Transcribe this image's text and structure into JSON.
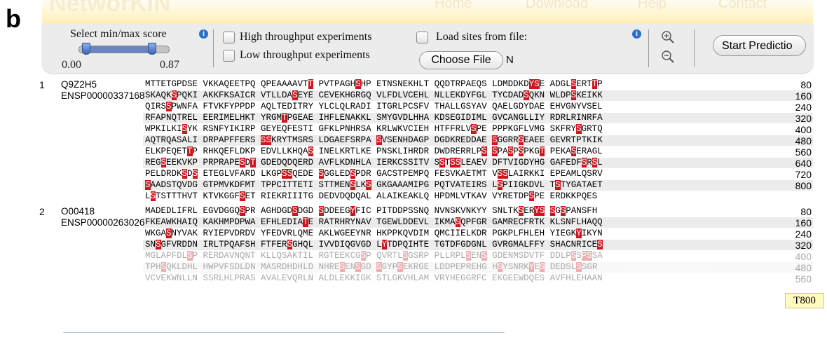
{
  "figure_label": "b",
  "banner": {
    "title": "NetworKIN",
    "nav": [
      "Home",
      "Download",
      "Help",
      "Contact"
    ]
  },
  "toolbar": {
    "score_label": "Select min/max score",
    "min_value": "0.00",
    "max_value": "0.87",
    "slider_min_fraction": 0.0,
    "slider_max_fraction": 0.87,
    "info_glyph": "i",
    "high_throughput_label": "High throughput experiments",
    "low_throughput_label": "Low throughput experiments",
    "load_sites_label": "Load sites from file:",
    "choose_file_label": "Choose File",
    "file_status": "N",
    "start_label": "Start Predictio",
    "zoom_in_icon": "zoom-in-icon",
    "zoom_out_icon": "zoom-out-icon"
  },
  "highlight_color": "#d2141c",
  "tooltip": "T800",
  "proteins": [
    {
      "index": "1",
      "ids": [
        "Q9Z2H5",
        "ENSP00000337168"
      ],
      "rows": [
        {
          "seq": "MTTETGPDSE VKKAQEETPQ QPEAAAAVT[T] PVTPAGH[S]HP ETNSNEKHLT QQDTRPAEQS LDMDDKD[YS]E ADGL[S]ERT[T]P",
          "pos": "80"
        },
        {
          "seq": "SKAQK[S]PQKI AKKFKSAICR VTLLDA[S]EYE CEVEKHGRGQ VLFDLVCEHL NLLEKDYFGL TYCDAD[S]QKN WLDP[S]KEIKK",
          "pos": "160"
        },
        {
          "seq": "QIRS[S]PWNFA FTVKFYPPDP AQLTEDITRY YLCLQLRADI ITGRLPCSFV THALLGSYAV QAELGDYDAE EHVGNYVSEL",
          "pos": "240"
        },
        {
          "seq": "RFAPNQTREL EERIMELHKT YRGM[T]PGEAE IHFLENAKKL SMYGVDLHHA KDSEGIDIML GVCANGLLIY RDRLRINRFA",
          "pos": "320"
        },
        {
          "seq": "WPKILKI[S]YK RSNFYIKIRP GEYEQFESTI GFKLPNHRSA KRLWKVCIEH HTFFRLV[S]PE PPPKGFLVMG SKFRY[S]GRTQ",
          "pos": "400"
        },
        {
          "seq": "AQTRQASALI DRPAPFFERS [SS]KRYTMSRS LDGAEFSRPA [S]VSENHDAGP DGDKREDDAE [S]GGRR[S]EAEE GEVRTPTKIK",
          "pos": "480"
        },
        {
          "seq": "ELKPEQET[T]P RHKQEFLDKP EDVLLKHQA[S] INELKRTLKE PNSKLIHRDR DWDRERRLP[S] [S]PA[S]P[S]PKG[T] PEKA[S]ERAGL",
          "pos": "560"
        },
        {
          "seq": "REG[S]EEKVKP PRPRAPE[S]D[T] GDEDQDQERD AVFLKDNHLA IERKCSSITV S[S]T[SS]LEAEV DFTVIGDYHG GAFEDF[S]R[S]L",
          "pos": "640"
        },
        {
          "seq": "PELDRDK[S]D[S] ETEGLVFARD LKGP[SS]QEDE [S]GGLED[S]PDR GACSTPEMPQ FESVKAETMT V[SS]LAIRKKI EPEAMLQSRV",
          "pos": "720"
        },
        {
          "seq": "[S]AADSTQVDG GTPMVKDFMT TPPCITTETI STTMEN[S]LK[S] GKGAAAMIPG PQTVATEIRS L[S]PIIGKDVL T[S]TYGATAET",
          "pos": "800"
        },
        {
          "seq": "L[S]TSTTTHVT KTVKGGF[S]ET RIEKRIIITG DEDVDQDQAL ALAIKEAKLQ HPDMLVTKAV VYRETDP[S]PE ERDKKPQES",
          "pos": ""
        }
      ]
    },
    {
      "index": "2",
      "ids": [
        "O00418",
        "ENSP00000263026"
      ],
      "rows": [
        {
          "seq": "MADEDLIFRL EGVDGGQ[S]PR AGHDGD[S]DGD [S]DDEEG[Y]FIC PITDDPSSNQ NVNSKVNKYY SNLTK[S]ER[YS] [S]G[S]PANSFH",
          "pos": "80"
        },
        {
          "seq": "FKEAWKHAIQ KAKHMPDPWA EFHLEDIA[T]E RATRHRYNAV TGEWLDDEVL IKMA[S]QPFGR GAMRECFRTK KLSNFLHAQQ",
          "pos": "160"
        },
        {
          "seq": "WKGA[S]NYVAK RYIEPVDRDV YFEDVRLQME AKLWGEEYNR HKPPKQVDIM QMCIIELKDR PGKPLFHLEH YIEGK[Y]IKYN",
          "pos": "240"
        },
        {
          "seq": "SN[S]GFVRDDN IRLTPQAFSH FTFER[S]GHQL IVVDIQGVGD L[Y]TDPQIHTE TGTDFGDGNL GVRGMALFFY SHACNRICE[S]",
          "pos": "320"
        },
        {
          "seq": "MGLAPFDL[S]P RERDAVNQNT KLLQSAKTIL RGTEEKCG[S]P QVRTL[S]GSRP PLLRPL[S]EN[S] GDENMSDVTF DDLP[S]S[PS]SA",
          "pos": "400",
          "fade": true
        },
        {
          "seq": "TPH[S]QKLDHL HWPVFSDLDN MASRDHDHLD NHRE[S]EN[S]GD [S]GYP[S]EKRGE LDDPEPREHG H[S]YSNRK[Y]E[S] DEDSL[S]SGR",
          "pos": "480",
          "fade": true
        },
        {
          "seq": "VCVEKWNLLN SSRLHLPRAS AVALEVQRLN ALDLEKKIGK STLGKVHLAM VRYHEGGRFC EKGEEWDQES AVFHLEHAAN",
          "pos": "560",
          "fade": true
        }
      ]
    }
  ]
}
